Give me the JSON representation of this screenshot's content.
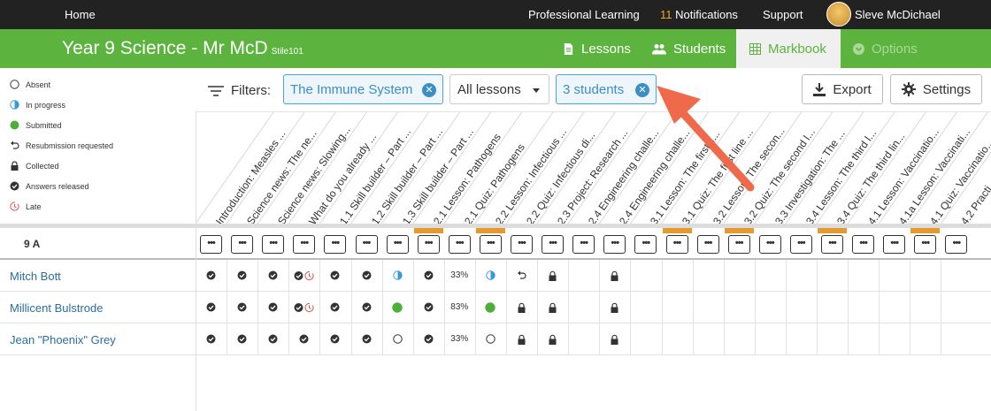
{
  "topbar": {
    "home": "Home",
    "professional_learning": "Professional Learning",
    "notifications_count": "11",
    "notifications_label": "Notifications",
    "support": "Support",
    "user_name": "Sleve McDichael"
  },
  "header": {
    "title": "Year 9 Science - Mr McD",
    "subtitle": "Stile101",
    "nav": [
      {
        "label": "Lessons",
        "icon": "document-icon",
        "state": "normal"
      },
      {
        "label": "Students",
        "icon": "people-icon",
        "state": "normal"
      },
      {
        "label": "Markbook",
        "icon": "grid-icon",
        "state": "active"
      },
      {
        "label": "Options",
        "icon": "chevron-down-circle-icon",
        "state": "disabled"
      }
    ],
    "colors": {
      "brand": "#5cb43f",
      "topbar": "#222222",
      "link": "#2b6ca3",
      "accent": "#e69a2e"
    }
  },
  "legend": [
    {
      "label": "Absent",
      "icon": "circle-outline-icon"
    },
    {
      "label": "In progress",
      "icon": "half-circle-icon"
    },
    {
      "label": "Submitted",
      "icon": "green-dot-icon"
    },
    {
      "label": "Resubmission requested",
      "icon": "undo-icon"
    },
    {
      "label": "Collected",
      "icon": "lock-icon"
    },
    {
      "label": "Answers released",
      "icon": "check-circle-icon"
    },
    {
      "label": "Late",
      "icon": "late-clock-icon"
    }
  ],
  "filters": {
    "label": "Filters:",
    "topic_chip": "The Immune System",
    "lessons_select": "All lessons",
    "students_chip": "3 students",
    "export_label": "Export",
    "settings_label": "Settings"
  },
  "columns": [
    "Introduction: Measles ...",
    "Science news: The ne...",
    "Science news: Slowing...",
    "What do you already ...",
    "1.1 Skill builder – Part ...",
    "1.2 Skill builder – Part ...",
    "1.3 Skill builder – Part ...",
    "2.1 Lesson: Pathogens",
    "2.1 Quiz: Pathogens",
    "2.2 Lesson: Infectious ...",
    "2.2 Quiz: Infectious di...",
    "2.3 Project: Research ...",
    "2.4 Engineering challe...",
    "2.4 Engineering challe...",
    "3.1 Lesson: The first li...",
    "3.1 Quiz: The first line ...",
    "3.2 Lesson: The secon...",
    "3.2 Quiz: The second l...",
    "3.3 Investigation: The ...",
    "3.4 Lesson: The third l...",
    "3.4 Quiz: The third lin...",
    "4.1 Lesson: Vaccinatio...",
    "4.1a Lesson: Vaccinati...",
    "4.1 Quiz: Vaccinatio...",
    "4.2 Practi..."
  ],
  "quiz_columns": [
    7,
    9,
    15,
    17,
    20,
    23
  ],
  "class_row": {
    "name": "9 A",
    "dots": "•••"
  },
  "students": [
    {
      "name": "Mitch Bott",
      "cells": [
        "check",
        "check",
        "check",
        "check-late",
        "check",
        "check",
        "half",
        "check",
        "33%",
        "half",
        "undo",
        "lock",
        "",
        "lock"
      ]
    },
    {
      "name": "Millicent Bulstrode",
      "cells": [
        "check",
        "check",
        "check",
        "check-late",
        "check",
        "check",
        "green",
        "check",
        "83%",
        "green",
        "lock",
        "lock",
        "",
        "lock"
      ]
    },
    {
      "name": "Jean \"Phoenix\" Grey",
      "cells": [
        "check",
        "check",
        "check",
        "check",
        "check",
        "check",
        "open",
        "check",
        "33%",
        "open",
        "lock",
        "lock",
        "",
        "lock"
      ]
    }
  ]
}
